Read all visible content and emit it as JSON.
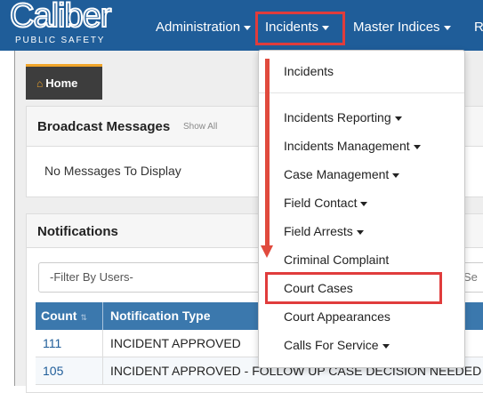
{
  "brand": {
    "name": "Caliber",
    "tagline": "PUBLIC SAFETY"
  },
  "nav": {
    "items": [
      {
        "label": "Administration"
      },
      {
        "label": "Incidents"
      },
      {
        "label": "Master Indices"
      },
      {
        "label": "R"
      }
    ]
  },
  "home_tab": {
    "label": "Home"
  },
  "broadcast": {
    "title": "Broadcast Messages",
    "show_all": "Show All",
    "empty_text": "No Messages To Display"
  },
  "notifications": {
    "title": "Notifications",
    "filter_placeholder": "-Filter By Users-",
    "search_placeholder": "Se",
    "columns": {
      "count": "Count",
      "type": "Notification Type"
    },
    "rows": [
      {
        "count": "111",
        "type": "INCIDENT APPROVED"
      },
      {
        "count": "105",
        "type": "INCIDENT APPROVED - FOLLOW UP CASE DECISION NEEDED"
      }
    ]
  },
  "incidents_menu": {
    "items": [
      {
        "label": "Incidents"
      },
      {
        "label": "Incidents Reporting"
      },
      {
        "label": "Incidents Management"
      },
      {
        "label": "Case Management"
      },
      {
        "label": "Field Contact"
      },
      {
        "label": "Field Arrests"
      },
      {
        "label": "Criminal Complaint"
      },
      {
        "label": "Court Cases"
      },
      {
        "label": "Court Appearances"
      },
      {
        "label": "Calls For Service"
      }
    ]
  },
  "colors": {
    "nav_bg": "#1f5d99",
    "highlight": "#e03c3c",
    "accent": "#f0a52a",
    "table_header": "#3b78ad"
  },
  "icons": {
    "home": "home-icon",
    "sort": "sort-icon",
    "caret": "caret-down-icon"
  }
}
